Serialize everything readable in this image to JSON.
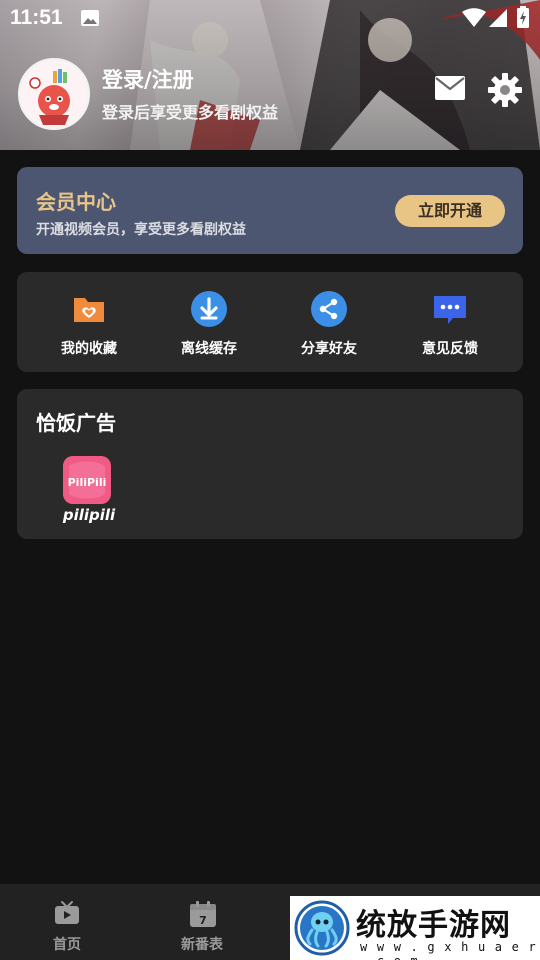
{
  "status_bar": {
    "time": "11:51"
  },
  "profile": {
    "title": "登录/注册",
    "subtitle": "登录后享受更多看剧权益"
  },
  "icons": {
    "mail": "mail-icon",
    "settings": "gear-icon"
  },
  "vip": {
    "title": "会员中心",
    "subtitle": "开通视频会员，享受更多看剧权益",
    "button": "立即开通"
  },
  "shortcuts": [
    {
      "label": "我的收藏",
      "icon": "favorites-folder-icon",
      "color": "#f08a3c"
    },
    {
      "label": "离线缓存",
      "icon": "download-icon",
      "color": "#3c8fe6"
    },
    {
      "label": "分享好友",
      "icon": "share-icon",
      "color": "#3c8fe6"
    },
    {
      "label": "意见反馈",
      "icon": "feedback-chat-icon",
      "color": "#3b64e8"
    }
  ],
  "ad_section": {
    "title": "恰饭广告",
    "apps": [
      {
        "label": "pilipili",
        "icon_text": "PiliPili"
      }
    ]
  },
  "bottom_nav": [
    {
      "label": "首页",
      "icon": "tv-icon"
    },
    {
      "label": "新番表",
      "icon": "calendar-icon",
      "icon_text": "7"
    }
  ],
  "watermark": {
    "text": "统放手游网",
    "url": "w w w . g x h u a e r . c o m"
  },
  "colors": {
    "background": "#121212",
    "card": "#2a2a2a",
    "vip_card": "#4c5670",
    "vip_gold": "#e9c585"
  }
}
